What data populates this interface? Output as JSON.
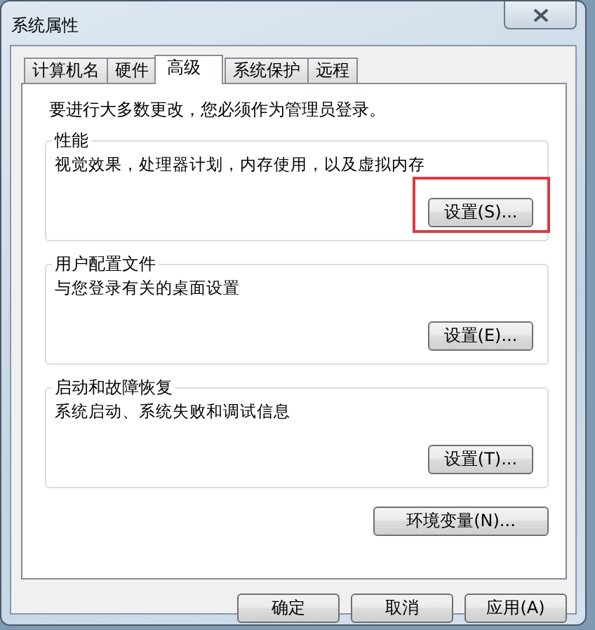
{
  "window": {
    "title": "系统属性"
  },
  "tabs": [
    {
      "label": "计算机名",
      "selected": false
    },
    {
      "label": "硬件",
      "selected": false
    },
    {
      "label": "高级",
      "selected": true
    },
    {
      "label": "系统保护",
      "selected": false
    },
    {
      "label": "远程",
      "selected": false
    }
  ],
  "notice": "要进行大多数更改，您必须作为管理员登录。",
  "groups": [
    {
      "title": "性能",
      "description": "视觉效果，处理器计划，内存使用，以及虚拟内存",
      "button": {
        "label": "设置(S)...",
        "highlighted": true
      }
    },
    {
      "title": "用户配置文件",
      "description": "与您登录有关的桌面设置",
      "button": {
        "label": "设置(E)...",
        "highlighted": false
      }
    },
    {
      "title": "启动和故障恢复",
      "description": "系统启动、系统失败和调试信息",
      "button": {
        "label": "设置(T)...",
        "highlighted": false
      }
    }
  ],
  "env_button": "环境变量(N)...",
  "buttons": [
    {
      "label": "确定"
    },
    {
      "label": "取消"
    },
    {
      "label": "应用(A)"
    }
  ]
}
